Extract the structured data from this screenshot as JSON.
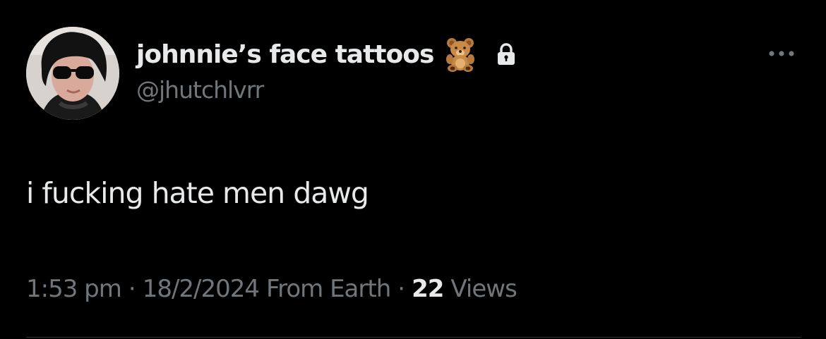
{
  "tweet": {
    "author": {
      "display_name": "johnnie’s face tattoos",
      "handle": "@jhutchlvrr",
      "avatar": "profile-photo",
      "name_emoji": "teddy-bear-icon",
      "protected_icon": "lock-icon"
    },
    "more_icon": "more-horizontal-icon",
    "text": "i fucking hate men dawg",
    "meta": {
      "time": "1:53 pm",
      "separator": "·",
      "date": "18/2/2024",
      "source": "From Earth",
      "views_count": "22",
      "views_label": "Views"
    }
  },
  "colors": {
    "background": "#000000",
    "primary_text": "#e7e9ea",
    "secondary_text": "#71767b",
    "divider": "#2f3336"
  }
}
